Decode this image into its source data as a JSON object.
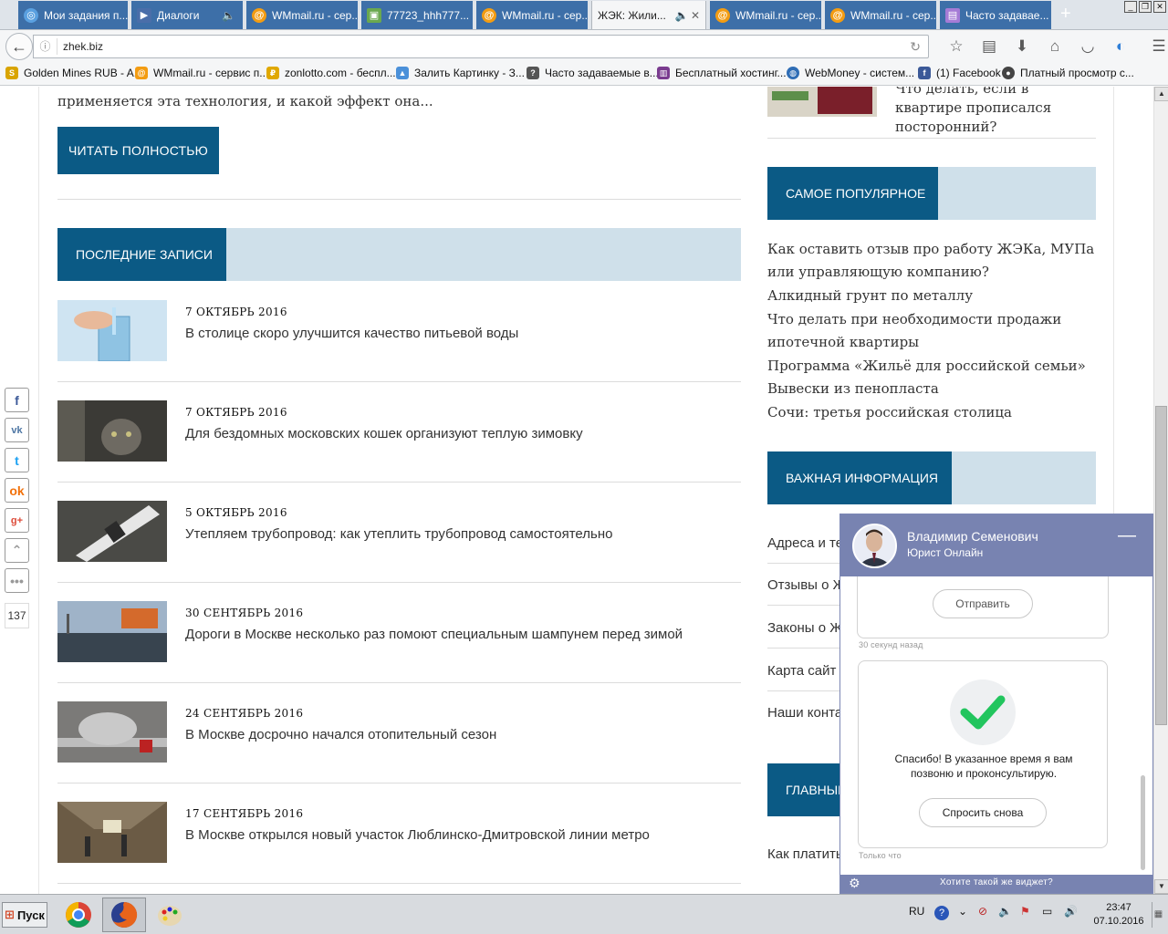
{
  "browser": {
    "tabs": [
      {
        "label": "Мои задания п...",
        "icon_color": "#5aa0e0",
        "icon": "circle-icon"
      },
      {
        "label": "Диалоги",
        "icon_color": "#4a6ea9",
        "icon": "play-icon"
      },
      {
        "label": "",
        "icon_color": "#3d6fa8",
        "icon": "speaker-icon"
      },
      {
        "label": "WMmail.ru - сер...",
        "icon_color": "#f39c12",
        "icon": "at-icon"
      },
      {
        "label": "77723_hhh777...",
        "icon_color": "#6aa84f",
        "icon": "image-icon"
      },
      {
        "label": "WMmail.ru - сер...",
        "icon_color": "#f39c12",
        "icon": "at-icon"
      },
      {
        "label": "ЖЭК: Жили...",
        "icon_color": "#cccccc",
        "icon": "page-icon",
        "active": true
      },
      {
        "label": "WMmail.ru - сер...",
        "icon_color": "#f39c12",
        "icon": "at-icon"
      },
      {
        "label": "WMmail.ru - сер...",
        "icon_color": "#f39c12",
        "icon": "at-icon"
      },
      {
        "label": "Часто задавае...",
        "icon_color": "#a57bd6",
        "icon": "page-icon"
      }
    ],
    "new_tab": "+",
    "url": "zhek.biz",
    "bookmarks": [
      {
        "label": "Golden Mines RUB - A...",
        "color": "#d9a400"
      },
      {
        "label": "WMmail.ru - сервис п...",
        "color": "#f39c12"
      },
      {
        "label": "zonlotto.com - беспл...",
        "color": "#e0a800"
      },
      {
        "label": "Залить Картинку - З...",
        "color": "#4a90d9"
      },
      {
        "label": "Часто задаваемые в...",
        "color": "#555555"
      },
      {
        "label": "Бесплатный хостинг...",
        "color": "#7a3b8f"
      },
      {
        "label": "WebMoney - систем...",
        "color": "#2f6db5"
      },
      {
        "label": "(1) Facebook",
        "color": "#3b5998"
      },
      {
        "label": "Платный просмотр с...",
        "color": "#444444"
      }
    ]
  },
  "page": {
    "intro_text": "применяется эта технология, и какой эффект она...",
    "read_more": "ЧИТАТЬ ПОЛНОСТЬЮ",
    "latest_heading": "ПОСЛЕДНИЕ ЗАПИСИ",
    "posts": [
      {
        "date": "7 ОКТЯБРЬ 2016",
        "title": "В столице скоро улучшится качество питьевой воды"
      },
      {
        "date": "7 ОКТЯБРЬ 2016",
        "title": "Для бездомных московских кошек организуют теплую зимовку"
      },
      {
        "date": "5 ОКТЯБРЬ 2016",
        "title": "Утепляем трубопровод: как утеплить трубопровод самостоятельно"
      },
      {
        "date": "30 СЕНТЯБРЬ 2016",
        "title": "Дороги в Москве несколько раз помоют специальным шампунем перед зимой"
      },
      {
        "date": "24 СЕНТЯБРЬ 2016",
        "title": "В Москве досрочно начался отопительный сезон"
      },
      {
        "date": "17 СЕНТЯБРЬ 2016",
        "title": "В Москве открылся новый участок Люблинско-Дмитровской линии метро"
      }
    ],
    "share_count": "137",
    "sidebar_article": "Что делать, если в квартире прописался посторонний?",
    "popular_heading": "САМОЕ ПОПУЛЯРНОЕ",
    "popular_links": [
      "Как оставить отзыв про работу ЖЭКа, МУПа или управляющую компанию?",
      "Алкидный грунт по металлу",
      "Что делать при необходимости продажи ипотечной квартиры",
      "Программа «Жильё для российской семьи»",
      "Вывески из пенопласта",
      "Сочи: третья российская столица"
    ],
    "important_heading": "ВАЖНАЯ ИНФОРМАЦИЯ",
    "important_links": [
      "Адреса и те",
      "Отзывы о Ж",
      "Законы о Ж",
      "Карта сайт",
      "Наши конта"
    ],
    "main_heading": "ГЛАВНЫЕ",
    "bottom_link": "Как платить"
  },
  "chat": {
    "name": "Владимир Семенович",
    "role": "Юрист Онлайн",
    "send_label": "Отправить",
    "ts1": "30 секунд назад",
    "thanks": "Спасибо! В указанное время я вам позвоню и проконсультирую.",
    "ask_again": "Спросить снова",
    "ts2": "Только что",
    "footer": "Хотите такой же виджет?"
  },
  "taskbar": {
    "start": "Пуск",
    "lang": "RU",
    "time": "23:47",
    "date": "07.10.2016"
  }
}
